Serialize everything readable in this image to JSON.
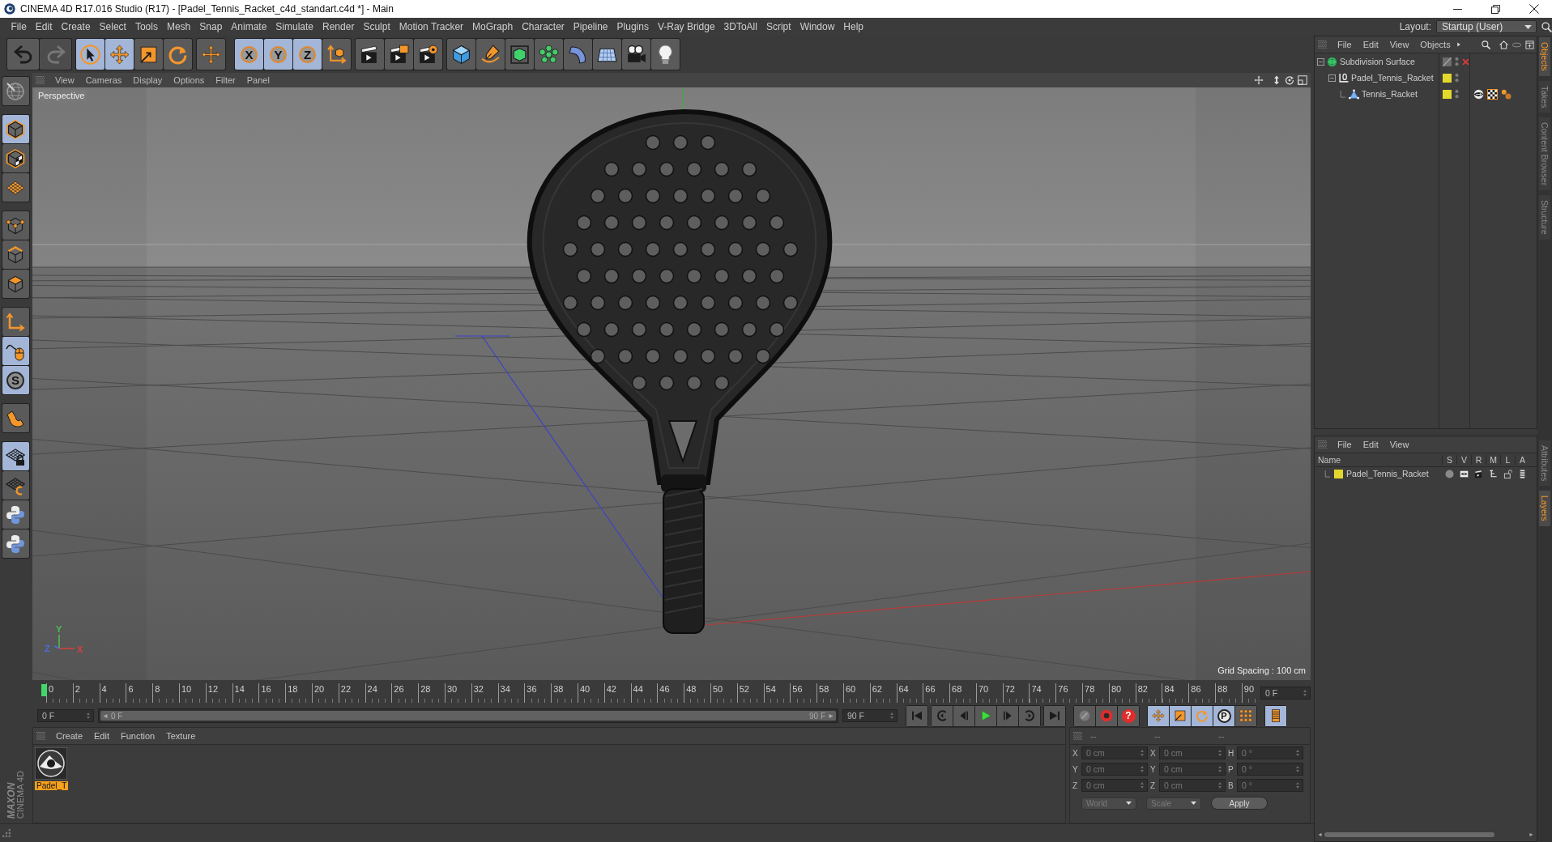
{
  "window": {
    "title": "CINEMA 4D R17.016 Studio (R17) - [Padel_Tennis_Racket_c4d_standart.c4d *] - Main"
  },
  "menu": [
    "File",
    "Edit",
    "Create",
    "Select",
    "Tools",
    "Mesh",
    "Snap",
    "Animate",
    "Simulate",
    "Render",
    "Sculpt",
    "Motion Tracker",
    "MoGraph",
    "Character",
    "Pipeline",
    "Plugins",
    "V-Ray Bridge",
    "3DToAll",
    "Script",
    "Window",
    "Help"
  ],
  "layout": {
    "label": "Layout:",
    "value": "Startup (User)"
  },
  "toolbar": {
    "history": [
      {
        "disabled": false
      },
      {
        "disabled": true
      }
    ],
    "tools": [
      {
        "selected": true
      },
      {
        "selected": true
      },
      {
        "selected": false
      },
      {
        "selected": false
      },
      {
        "selected": false
      }
    ],
    "axes": [
      {
        "label": "X",
        "selected": true
      },
      {
        "label": "Y",
        "selected": true
      },
      {
        "label": "Z",
        "selected": true
      }
    ]
  },
  "left_toolbar": [
    [
      {
        "selected": true
      },
      {
        "selected": false
      },
      {
        "selected": false
      }
    ],
    [
      {
        "selected": false
      },
      {
        "selected": false
      },
      {
        "selected": false
      }
    ],
    [
      {
        "selected": false
      },
      {
        "selected": true
      },
      {
        "label": "S",
        "selected": true
      }
    ],
    [
      {
        "selected": false
      }
    ],
    [
      {
        "selected": true
      },
      {
        "selected": false
      }
    ]
  ],
  "logo": [
    "MAXON",
    "CINEMA 4D"
  ],
  "viewport": {
    "menu": [
      "View",
      "Cameras",
      "Display",
      "Options",
      "Filter",
      "Panel"
    ],
    "camera": "Perspective",
    "grid_spacing": "Grid Spacing : 100 cm",
    "gizmo": [
      {
        "label": "Y",
        "color": "#4cc04c"
      },
      {
        "label": "Z",
        "color": "#4a6ee0"
      },
      {
        "label": "X",
        "color": "#d84040"
      }
    ]
  },
  "timeline": {
    "ticks": [
      "0",
      "2",
      "4",
      "6",
      "8",
      "10",
      "12",
      "14",
      "16",
      "18",
      "20",
      "22",
      "24",
      "26",
      "28",
      "30",
      "32",
      "34",
      "36",
      "38",
      "40",
      "42",
      "44",
      "46",
      "48",
      "50",
      "52",
      "54",
      "56",
      "58",
      "60",
      "62",
      "64",
      "66",
      "68",
      "70",
      "72",
      "74",
      "76",
      "78",
      "80",
      "82",
      "84",
      "86",
      "88",
      "90"
    ],
    "frame": "0 F"
  },
  "transport": {
    "start": "0 F",
    "range": {
      "start": "0 F",
      "end": "90 F",
      "level": 1
    },
    "end": "90 F",
    "autokey": "?",
    "keys": [
      {
        "on": true
      },
      {
        "on": true
      },
      {
        "on": true
      },
      {
        "label": "P",
        "on": true
      },
      {
        "on": false
      }
    ],
    "timeline_window": {
      "on": true
    }
  },
  "material_manager": {
    "menu": [
      "Create",
      "Edit",
      "Function",
      "Texture"
    ],
    "materials": [
      {
        "name": "Padel_T",
        "selected": true
      }
    ]
  },
  "coordinates": {
    "headers": [
      "--",
      "--",
      "--"
    ],
    "rows": [
      {
        "label": "X",
        "position": "0 cm",
        "size_label": "X",
        "size": "0 cm",
        "rotation_label": "H",
        "rotation": "0 °"
      },
      {
        "label": "Y",
        "position": "0 cm",
        "size_label": "Y",
        "size": "0 cm",
        "rotation_label": "P",
        "rotation": "0 °"
      },
      {
        "label": "Z",
        "position": "0 cm",
        "size_label": "Z",
        "size": "0 cm",
        "rotation_label": "B",
        "rotation": "0 °"
      }
    ],
    "mode": "World",
    "size_mode": "Scale",
    "apply": "Apply"
  },
  "object_manager": {
    "menu": [
      "File",
      "Edit",
      "View",
      "Objects"
    ],
    "objects": [
      {
        "name": "Subdivision Surface",
        "kind": "subdivision",
        "expanded": true,
        "enabled": false,
        "children": [
          {
            "name": "Padel_Tennis_Racket",
            "kind": "null",
            "expanded": true,
            "color": "#e3d82c",
            "children": [
              {
                "name": "Tennis_Racket",
                "kind": "polygon",
                "color": "#e3d82c",
                "tags": [
                  {
                    "kind": "phong"
                  },
                  {
                    "kind": "material"
                  },
                  {
                    "kind": "selection"
                  }
                ]
              }
            ]
          }
        ]
      }
    ]
  },
  "layer_manager": {
    "menu": [
      "File",
      "Edit",
      "View"
    ],
    "columns": [
      "Name",
      "S",
      "V",
      "R",
      "M",
      "L",
      "A"
    ],
    "layers": [
      {
        "name": "Padel_Tennis_Racket",
        "color": "#e3d82c",
        "solo": false,
        "visible": true,
        "render": true,
        "manager": true,
        "locked": false,
        "animation": true
      }
    ]
  },
  "side_tabs": {
    "top": [
      {
        "label": "Objects",
        "selected": true
      },
      {
        "label": "Takes",
        "selected": false
      },
      {
        "label": "Content Browser",
        "selected": false
      },
      {
        "label": "Structure",
        "selected": false
      }
    ],
    "bottom": [
      {
        "label": "Attributes",
        "selected": false
      },
      {
        "label": "Layers",
        "selected": true
      }
    ]
  }
}
